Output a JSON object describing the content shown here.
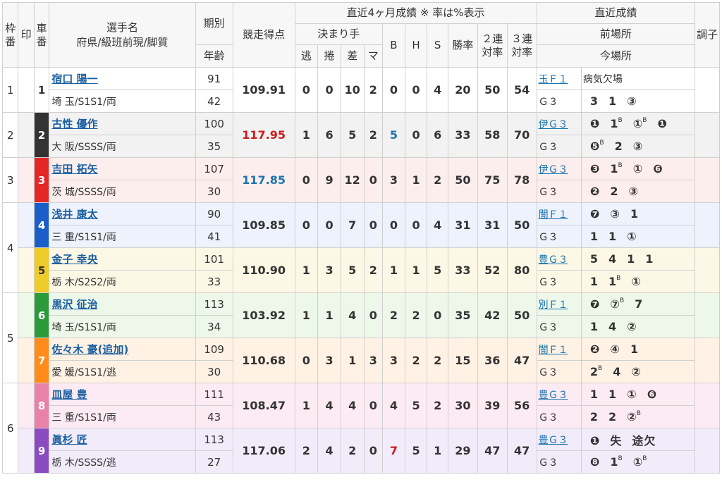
{
  "header": {
    "waku": "枠番",
    "shirushi": "印",
    "car": "車番",
    "name1": "選手名",
    "name2": "府県/級班前現/脚質",
    "period": "期別",
    "age": "年齢",
    "score": "競走得点",
    "recent_title": "直近4ヶ月成績 ※ 率は%表示",
    "kimarite": "決まり手",
    "nige": "逃",
    "makuri": "捲",
    "sashi": "差",
    "ma": "マ",
    "b": "B",
    "h": "H",
    "s": "S",
    "win": "勝率",
    "ren2": "２連対率",
    "ren3": "３連対率",
    "chokkin": "直近成績",
    "zenba": "前場所",
    "imaba": "今場所",
    "choushi": "調子"
  },
  "riders": [
    {
      "waku": "1",
      "car": "1",
      "name": "宿口 陽一",
      "pref": "埼 玉/S1S1/両",
      "period": "91",
      "age": "42",
      "score": "109.91",
      "nige": "0",
      "makuri": "0",
      "sashi": "10",
      "ma": "2",
      "b": "0",
      "h": "0",
      "s": "4",
      "win": "20",
      "ren2": "50",
      "ren3": "54",
      "prev_venue": "玉Ｆ１",
      "prev_res": "病気欠場",
      "cur_venue": "Ｇ３",
      "cur_res": "3 1 ③"
    },
    {
      "waku": "2",
      "car": "2",
      "name": "古性 優作",
      "pref": "大 阪/SSSS/両",
      "period": "100",
      "age": "35",
      "score": "117.95",
      "nige": "1",
      "makuri": "6",
      "sashi": "5",
      "ma": "2",
      "b": "5",
      "h": "0",
      "s": "6",
      "win": "33",
      "ren2": "58",
      "ren3": "70",
      "prev_venue": "伊Ｇ３",
      "prev_res": "❶ 1ᴮ ①ᴮ ❶",
      "cur_venue": "Ｇ３",
      "cur_res": "❺ᴮ 2 ③"
    },
    {
      "waku": "3",
      "car": "3",
      "name": "吉田 拓矢",
      "pref": "茨 城/SSSS/両",
      "period": "107",
      "age": "30",
      "score": "117.85",
      "nige": "0",
      "makuri": "9",
      "sashi": "12",
      "ma": "0",
      "b": "3",
      "h": "1",
      "s": "2",
      "win": "50",
      "ren2": "75",
      "ren3": "78",
      "prev_venue": "伊Ｇ３",
      "prev_res": "❸ 1ᴮ ① ❻",
      "cur_venue": "Ｇ３",
      "cur_res": "❷ 2 ③"
    },
    {
      "waku": "4",
      "car": "4",
      "name": "浅井 康太",
      "pref": "三 重/S1S1/両",
      "period": "90",
      "age": "41",
      "score": "109.85",
      "nige": "0",
      "makuri": "0",
      "sashi": "7",
      "ma": "0",
      "b": "0",
      "h": "0",
      "s": "4",
      "win": "31",
      "ren2": "31",
      "ren3": "50",
      "prev_venue": "闇Ｆ１",
      "prev_res": "❼ ③ 1",
      "cur_venue": "Ｇ３",
      "cur_res": "1 1 ①"
    },
    {
      "waku": "4",
      "car": "5",
      "name": "金子 幸央",
      "pref": "栃 木/S2S2/両",
      "period": "101",
      "age": "33",
      "score": "110.90",
      "nige": "1",
      "makuri": "3",
      "sashi": "5",
      "ma": "2",
      "b": "1",
      "h": "1",
      "s": "5",
      "win": "33",
      "ren2": "52",
      "ren3": "80",
      "prev_venue": "豊Ｇ３",
      "prev_res": "5 4 1 1",
      "cur_venue": "Ｇ３",
      "cur_res": "1 1ᴮ ①"
    },
    {
      "waku": "5",
      "car": "6",
      "name": "黒沢 征治",
      "pref": "埼 玉/S1S1/両",
      "period": "113",
      "age": "34",
      "score": "103.92",
      "nige": "1",
      "makuri": "1",
      "sashi": "4",
      "ma": "0",
      "b": "2",
      "h": "2",
      "s": "0",
      "win": "35",
      "ren2": "42",
      "ren3": "50",
      "prev_venue": "別Ｆ１",
      "prev_res": "❼ ⑦ᴮ 7",
      "cur_venue": "Ｇ３",
      "cur_res": "1 4 ②"
    },
    {
      "waku": "5",
      "car": "7",
      "name": "佐々木 豪(追加)",
      "pref": "愛 媛/S1S1/逃",
      "period": "109",
      "age": "30",
      "score": "110.68",
      "nige": "0",
      "makuri": "3",
      "sashi": "1",
      "ma": "3",
      "b": "3",
      "h": "2",
      "s": "2",
      "win": "15",
      "ren2": "36",
      "ren3": "47",
      "prev_venue": "闇Ｆ１",
      "prev_res": "❷ ④ 1",
      "cur_venue": "Ｇ３",
      "cur_res": "2ᴮ 4 ②"
    },
    {
      "waku": "6",
      "car": "8",
      "name": "皿屋 豊",
      "pref": "三 重/S1S1/両",
      "period": "111",
      "age": "43",
      "score": "108.47",
      "nige": "1",
      "makuri": "4",
      "sashi": "4",
      "ma": "0",
      "b": "4",
      "h": "5",
      "s": "2",
      "win": "30",
      "ren2": "39",
      "ren3": "56",
      "prev_venue": "豊Ｇ３",
      "prev_res": "1 1 ① ❻",
      "cur_venue": "Ｇ３",
      "cur_res": "2 2 ②ᴮ"
    },
    {
      "waku": "6",
      "car": "9",
      "name": "眞杉 匠",
      "pref": "栃 木/SSSS/逃",
      "period": "113",
      "age": "27",
      "score": "117.06",
      "nige": "2",
      "makuri": "4",
      "sashi": "2",
      "ma": "0",
      "b": "7",
      "h": "5",
      "s": "1",
      "win": "29",
      "ren2": "47",
      "ren3": "47",
      "prev_venue": "豊Ｇ３",
      "prev_res": "❶ 失 途欠",
      "cur_venue": "Ｇ３",
      "cur_res": "❽ 1ᴮ ①ᴮ"
    }
  ],
  "colors": {
    "score_high": "#cc1a1a",
    "score_second": "#1a74b0",
    "b_high": "#1a74b0",
    "b_highest": "#cc1a1a"
  }
}
